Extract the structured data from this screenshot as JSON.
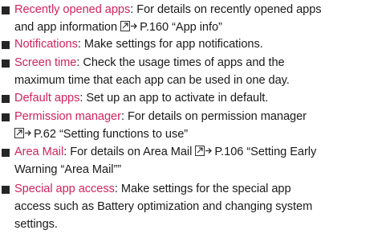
{
  "items": [
    {
      "term": "Recently opened apps",
      "line1": ": For details on recently opened apps",
      "line2_before": "and app information",
      "ref_icon": "reference-arrow-icon",
      "line2_after": "P.160 “App info”"
    },
    {
      "term": "Notifications",
      "line1": ": Make settings for app notifications."
    },
    {
      "term": "Screen time",
      "line1": ": Check the usage times of apps and the",
      "line2": "maximum time that each app can be used in one day."
    },
    {
      "term": "Default apps",
      "line1": ": Set up an app to activate in default."
    },
    {
      "term": "Permission manager",
      "line1": ": For details on permission manager",
      "ref_icon": "reference-arrow-icon",
      "line2_after": "P.62 “Setting functions to use”"
    },
    {
      "term": "Area Mail",
      "line1_before": ": For details on Area Mail",
      "ref_icon": "reference-arrow-icon",
      "line1_after": "P.106 “Setting Early",
      "line2": "Warning “Area Mail””"
    },
    {
      "term": "Special app access",
      "line1": ": Make settings for the special app",
      "line2": "access such as Battery optimization and changing system",
      "line3": "settings."
    }
  ],
  "colors": {
    "term": "#d1235f",
    "text": "#1a1a1a",
    "bullet": "#262626"
  }
}
